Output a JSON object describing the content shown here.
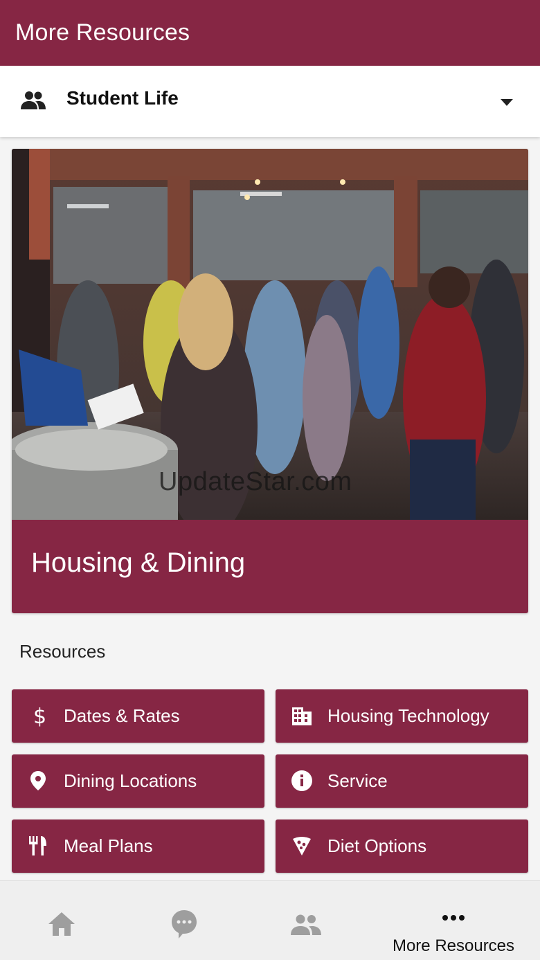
{
  "app_bar": {
    "title": "More Resources"
  },
  "selector": {
    "label": "Student Life",
    "icon": "people-icon"
  },
  "hero": {
    "title": "Housing & Dining"
  },
  "watermark": "UpdateStar.com",
  "resources": {
    "heading": "Resources",
    "items": [
      {
        "label": "Dates & Rates",
        "icon": "dollar-icon"
      },
      {
        "label": "Housing Technology",
        "icon": "building-icon"
      },
      {
        "label": "Dining Locations",
        "icon": "location-pin-icon"
      },
      {
        "label": "Service",
        "icon": "info-icon"
      },
      {
        "label": "Meal Plans",
        "icon": "restaurant-icon"
      },
      {
        "label": "Diet Options",
        "icon": "pizza-icon"
      }
    ]
  },
  "bottom_nav": {
    "items": [
      {
        "icon": "home-icon",
        "label": ""
      },
      {
        "icon": "chat-icon",
        "label": ""
      },
      {
        "icon": "people-icon",
        "label": ""
      },
      {
        "icon": "more-icon",
        "label": "More Resources"
      }
    ],
    "active_index": 3
  },
  "colors": {
    "brand": "#862644",
    "nav_inactive": "#9e9e9e",
    "background": "#f4f4f4"
  }
}
